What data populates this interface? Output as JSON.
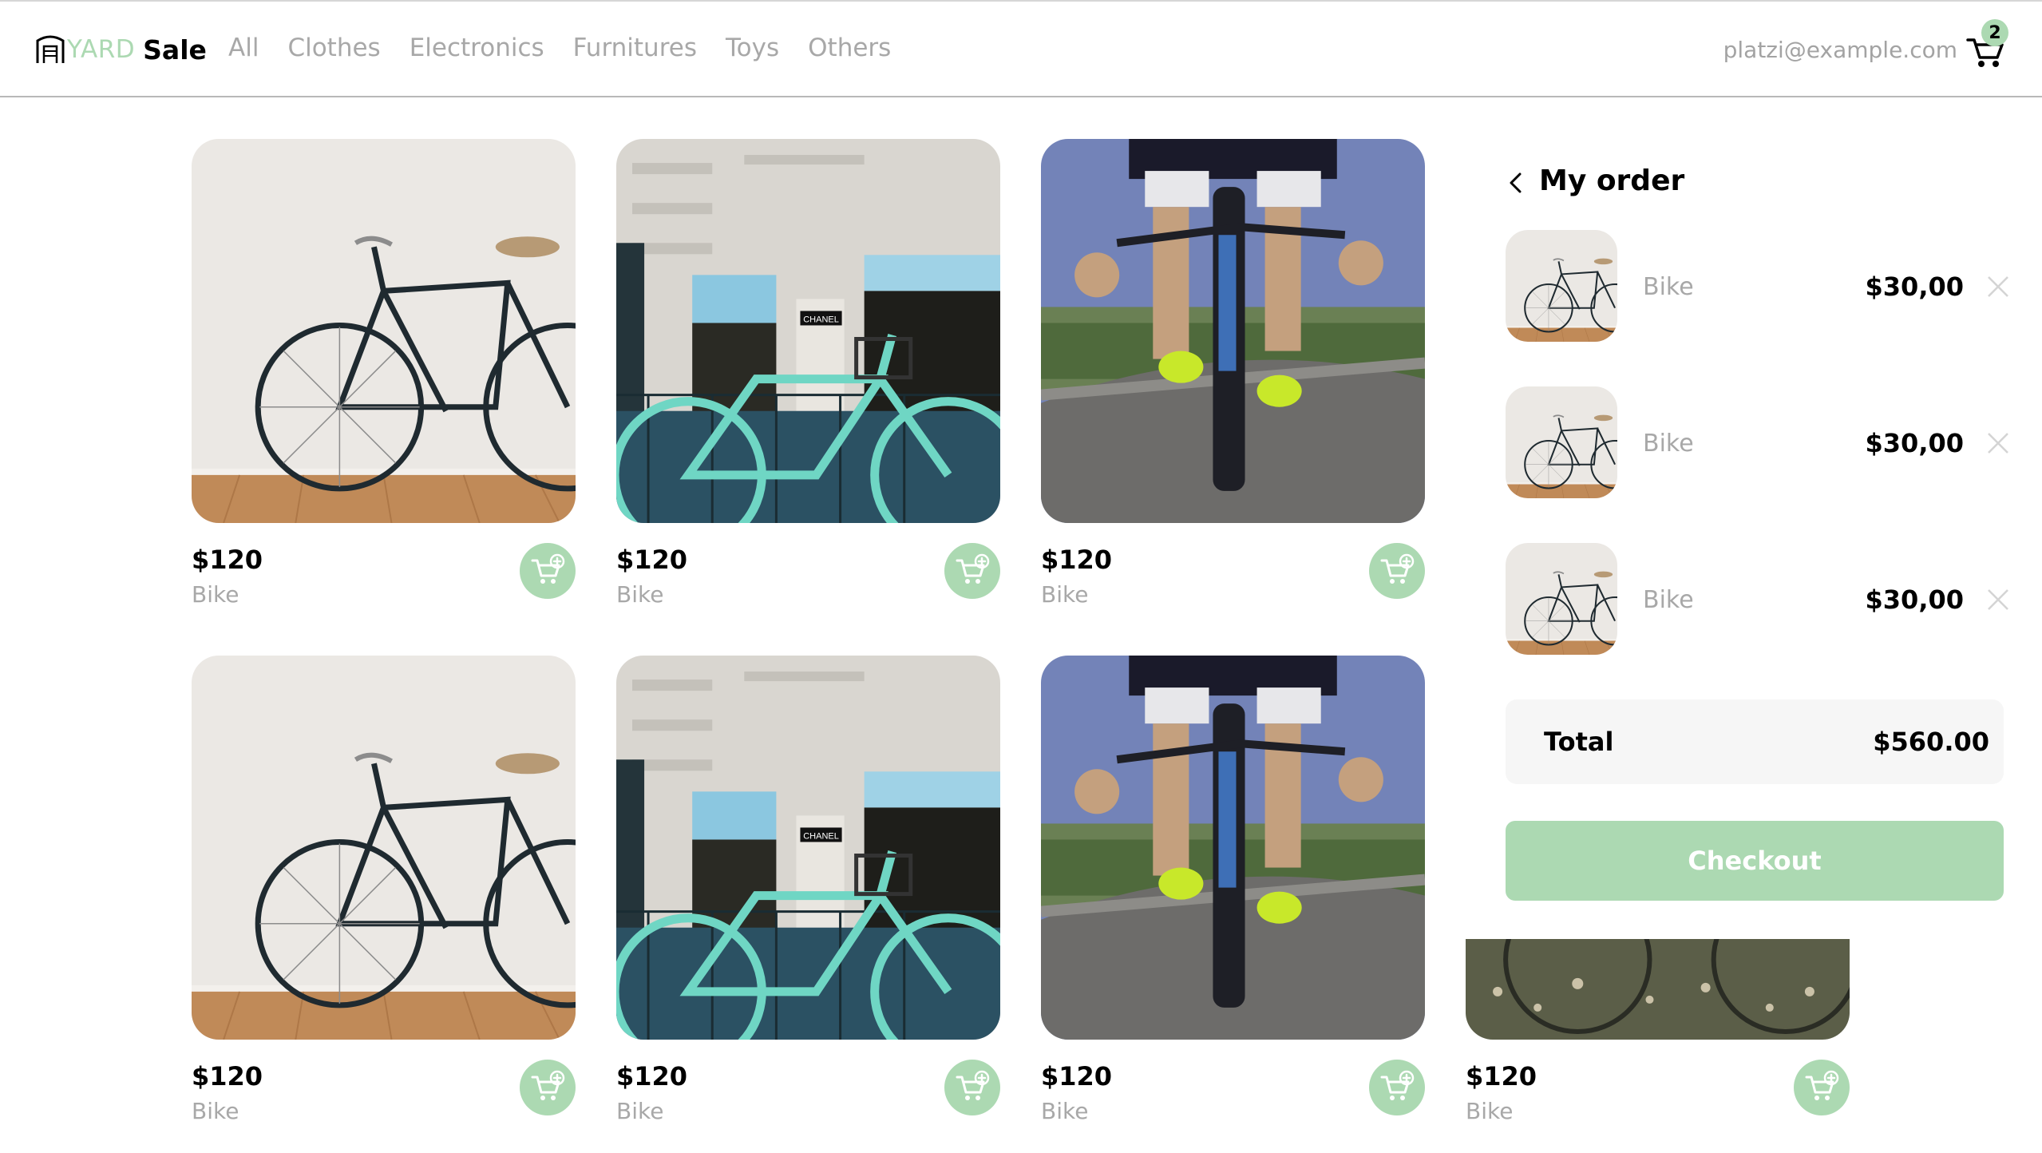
{
  "brand": {
    "word1": "YARD",
    "word2": "Sale",
    "accent": "#acd9b2"
  },
  "nav": {
    "links": [
      "All",
      "Clothes",
      "Electronics",
      "Furnitures",
      "Toys",
      "Others"
    ],
    "email": "platzi@example.com",
    "cart_count": "2"
  },
  "products": [
    {
      "price": "$120",
      "name": "Bike",
      "image": "bike-against-white-wall"
    },
    {
      "price": "$120",
      "name": "Bike",
      "image": "teal-bike-chanel-storefront"
    },
    {
      "price": "$120",
      "name": "Bike",
      "image": "road-cyclist"
    },
    {
      "price": "$120",
      "name": "Bike",
      "image": "bike-against-white-wall"
    },
    {
      "price": "$120",
      "name": "Bike",
      "image": "teal-bike-chanel-storefront"
    },
    {
      "price": "$120",
      "name": "Bike",
      "image": "road-cyclist"
    },
    {
      "price": "$120",
      "name": "Bike",
      "image": "bike-in-meadow"
    }
  ],
  "order": {
    "title": "My order",
    "items": [
      {
        "name": "Bike",
        "price": "$30,00"
      },
      {
        "name": "Bike",
        "price": "$30,00"
      },
      {
        "name": "Bike",
        "price": "$30,00"
      }
    ],
    "total_label": "Total",
    "total_value": "$560.00",
    "checkout_label": "Checkout"
  }
}
